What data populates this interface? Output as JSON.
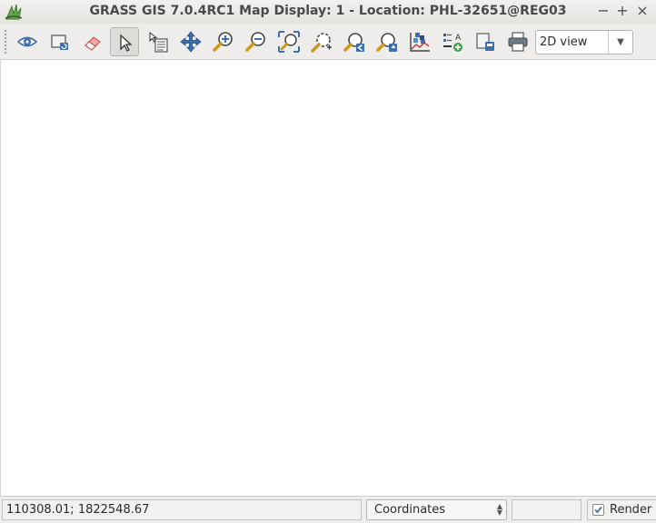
{
  "window": {
    "title": "GRASS GIS 7.0.4RC1 Map Display: 1 - Location: PHL-32651@REG03",
    "app_icon": "grass-logo-icon",
    "controls": {
      "minimize": "−",
      "maximize": "+",
      "close": "×"
    }
  },
  "toolbar": {
    "tools": [
      {
        "name": "display-map-icon"
      },
      {
        "name": "render-map-icon"
      },
      {
        "name": "erase-display-icon"
      },
      {
        "name": "pointer-icon",
        "active": true
      },
      {
        "name": "query-icon"
      },
      {
        "name": "pan-icon"
      },
      {
        "name": "zoom-in-icon"
      },
      {
        "name": "zoom-out-icon"
      },
      {
        "name": "zoom-extent-icon"
      },
      {
        "name": "zoom-region-icon"
      },
      {
        "name": "zoom-back-icon"
      },
      {
        "name": "zoom-options-icon"
      },
      {
        "name": "analyze-icon"
      },
      {
        "name": "overlay-icon"
      },
      {
        "name": "save-image-icon"
      },
      {
        "name": "print-icon"
      }
    ],
    "view_mode": {
      "selected": "2D view"
    }
  },
  "statusbar": {
    "coordinates": "110308.01; 1822548.67",
    "mode": {
      "selected": "Coordinates"
    },
    "render": {
      "label": "Render",
      "checked": true
    }
  },
  "colors": {
    "accent_blue": "#3b6fb0",
    "zoom_magnifier": "#c79a1d"
  }
}
